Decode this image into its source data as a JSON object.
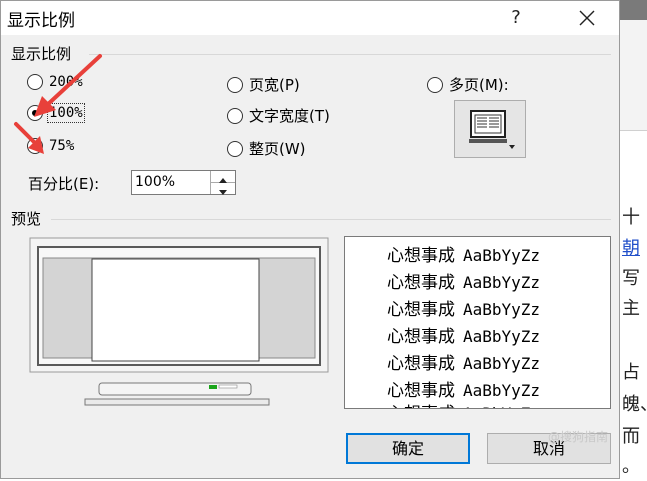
{
  "dialog": {
    "title": "显示比例",
    "help_label": "?",
    "zoom_group_label": "显示比例",
    "options_left": [
      {
        "label": "200%",
        "checked": false
      },
      {
        "label": "100%",
        "checked": true
      },
      {
        "label": "75%",
        "checked": false
      }
    ],
    "options_mid": [
      {
        "label": "页宽(P)",
        "checked": false
      },
      {
        "label": "文字宽度(T)",
        "checked": false
      },
      {
        "label": "整页(W)",
        "checked": false
      }
    ],
    "multipage_label": "多页(M):",
    "percent_label": "百分比(E):",
    "percent_value": "100%",
    "preview_group_label": "预览",
    "sample_text_cjk": "心想事成",
    "sample_text_latin": "AaBbYyZz",
    "ok_label": "确定",
    "cancel_label": "取消"
  },
  "background_doc": {
    "lines": [
      "十",
      "朝",
      "写",
      "主",
      "占",
      "魄、",
      "而",
      "。"
    ]
  },
  "watermark": "@搜狗指南",
  "colors": {
    "dialog_bg": "#f0f0f0",
    "focus_border": "#0078d7",
    "annotation_arrow": "#e8403a"
  }
}
